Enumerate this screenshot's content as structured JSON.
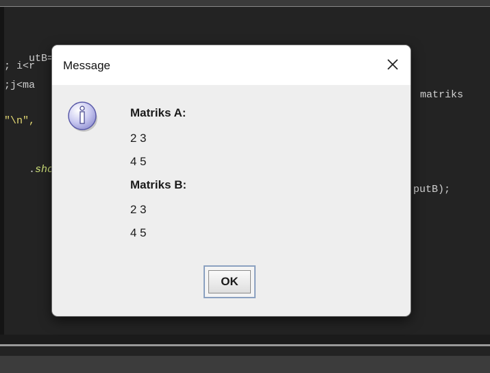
{
  "background_code": {
    "lines": [
      {
        "segments": [
          {
            "t": "utB=",
            "c": ""
          },
          {
            "t": "\"",
            "c": "str"
          }
        ]
      },
      {
        "segments": [
          {
            "t": "; i<r",
            "c": ""
          }
        ]
      },
      {
        "segments": [
          {
            "t": ";j<ma",
            "c": ""
          }
        ]
      },
      {
        "segments": [
          {
            "t": "\"\\n\",",
            "c": "str"
          }
        ]
      },
      {
        "segments": [
          {
            "t": ".",
            "c": ""
          },
          {
            "t": "sho",
            "c": "it"
          }
        ]
      }
    ],
    "right_lines": [
      {
        "text": "matriks"
      },
      {
        "text": "putB);"
      }
    ]
  },
  "dialog": {
    "title": "Message",
    "icon": "info-icon",
    "lines": [
      {
        "text": "Matriks A:",
        "bold": true
      },
      {
        "text": "2 3",
        "bold": false
      },
      {
        "text": "4 5",
        "bold": false
      },
      {
        "text": "Matriks B:",
        "bold": true
      },
      {
        "text": "2 3",
        "bold": false
      },
      {
        "text": "4 5",
        "bold": false
      }
    ],
    "ok_label": "OK"
  },
  "colors": {
    "editor_bg": "#232323",
    "dialog_bg": "#eeeeee",
    "string_color": "#e6db74"
  }
}
